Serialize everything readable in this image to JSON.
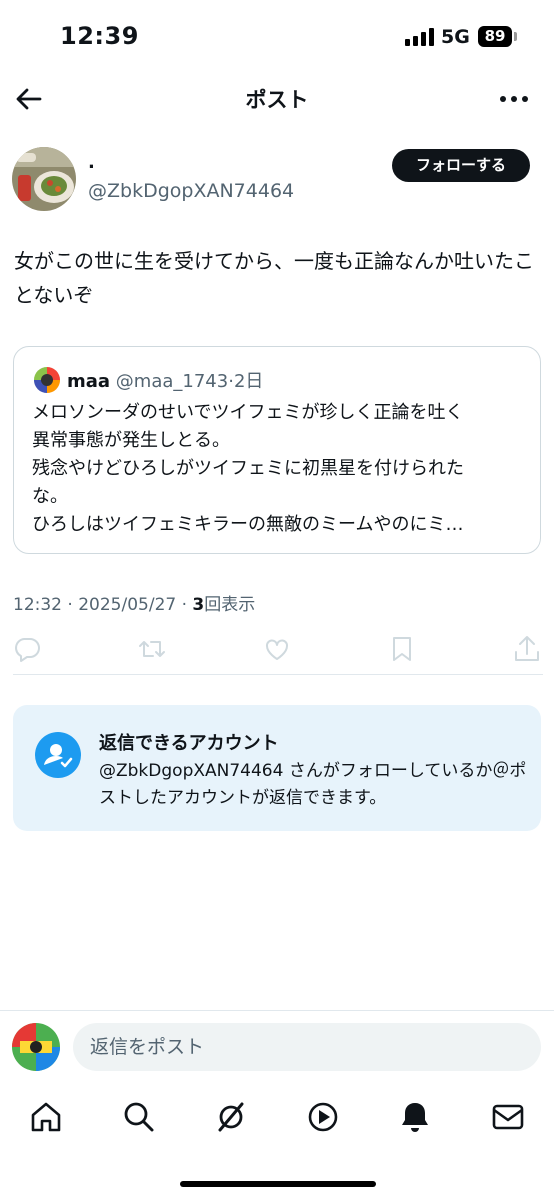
{
  "status_bar": {
    "time": "12:39",
    "network": "5G",
    "battery": "89"
  },
  "header": {
    "title": "ポスト",
    "back_icon": "arrow-left-icon",
    "more_icon": "ellipsis-icon"
  },
  "author": {
    "name": ".",
    "handle": "@ZbkDgopXAN74464",
    "follow_label": "フォローする"
  },
  "post": {
    "text": "女がこの世に生を受けてから、一度も正論なんか吐いたことないぞ",
    "time": "12:32",
    "date": "2025/05/27",
    "views_count": "3",
    "views_label": "回表示"
  },
  "quote": {
    "name": "maa",
    "handle": "@maa_1743",
    "age": "2日",
    "lines": [
      "メロソンーダのせいでツイフェミが珍しく正論を吐く",
      "異常事態が発生しとる。",
      "残念やけどひろしがツイフェミに初黒星を付けられた",
      "な。",
      "ひろしはツイフェミキラーの無敵のミームやのにミ…"
    ]
  },
  "actions": [
    "reply-icon",
    "repost-icon",
    "like-icon",
    "bookmark-icon",
    "share-icon"
  ],
  "reply_info": {
    "title": "返信できるアカウント",
    "body": "@ZbkDgopXAN74464 さんがフォローしているか＠ポストしたアカウントが返信できます。"
  },
  "reply_bar": {
    "placeholder": "返信をポスト"
  },
  "tabs": [
    "home-icon",
    "search-icon",
    "grok-icon",
    "video-icon",
    "notifications-icon",
    "messages-icon"
  ],
  "colors": {
    "accent": "#1d9bf0",
    "text": "#0f1419",
    "muted": "#536471",
    "reply_bg": "#e7f3fb"
  }
}
